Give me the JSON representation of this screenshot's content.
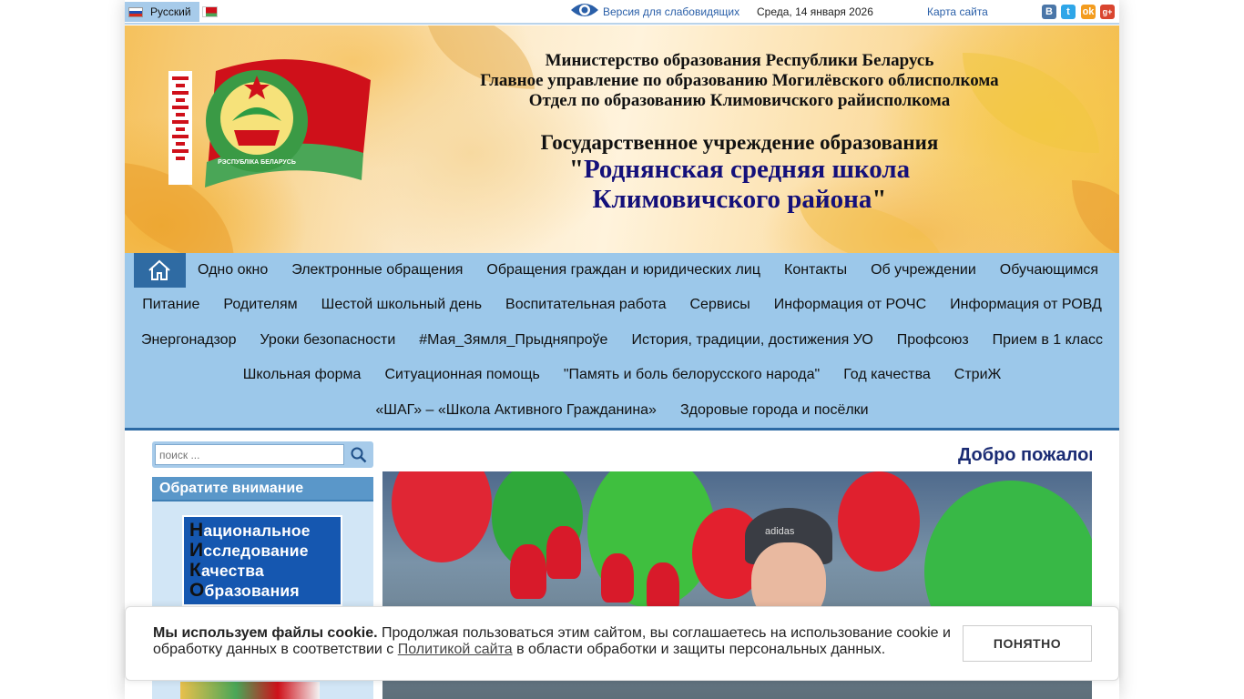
{
  "topbar": {
    "language": "Русский",
    "vision_link": "Версия для слабовидящих",
    "date": "Среда, 14 января 2026",
    "sitemap": "Карта сайта",
    "social": [
      {
        "icon": "vk-icon",
        "glyph": "В"
      },
      {
        "icon": "twitter-icon",
        "glyph": "t"
      },
      {
        "icon": "odnoklassniki-icon",
        "glyph": "ok"
      },
      {
        "icon": "google-plus-icon",
        "glyph": "g+"
      }
    ]
  },
  "header": {
    "line1": "Министерство образования Республики Беларусь",
    "line2": "Главное управление по образованию Могилёвского облисполкома",
    "line3": "Отдел по образованию Климовичского райисполкома",
    "line4": "Государственное учреждение образования",
    "line5": "Роднянская средняя школа",
    "line6": "Климовичского района",
    "quote_open": "\"",
    "quote_close": "\"",
    "emblem_text": "РЭСПУБЛІКА БЕЛАРУСЬ"
  },
  "nav": {
    "rows": [
      [
        "Одно окно",
        "Электронные обращения",
        "Обращения граждан и юридических лиц",
        "Контакты",
        "Об учреждении",
        "Обучающимся"
      ],
      [
        "Питание",
        "Родителям",
        "Шестой школьный день",
        "Воспитательная работа",
        "Сервисы",
        "Информация от РОЧС",
        "Информация от РОВД"
      ],
      [
        "Энергонадзор",
        "Уроки безопасности",
        "#Мая_Зямля_Прыдняпроўе",
        "История, традиции, достижения УО",
        "Профсоюз",
        "Прием в 1 класс"
      ],
      [
        "Школьная форма",
        "Ситуационная помощь",
        "\"Память и боль белорусского народа\"",
        "Год качества",
        "СтриЖ"
      ],
      [
        "«ШАГ» – «Школа Активного Гражданина»",
        "Здоровые города и посёлки"
      ]
    ]
  },
  "sidebar": {
    "search_placeholder": "поиск ...",
    "notice_title": "Обратите внимание",
    "niko": [
      {
        "first": "Н",
        "rest": "ациональное"
      },
      {
        "first": "И",
        "rest": "сследование"
      },
      {
        "first": "К",
        "rest": "ачества"
      },
      {
        "first": "О",
        "rest": "бразования"
      }
    ]
  },
  "main": {
    "welcome": "Добро пожаловать"
  },
  "photo": {
    "hat_brand": "adidas"
  },
  "cookie": {
    "bold": "Мы используем файлы cookie.",
    "text1": " Продолжая пользоваться этим сайтом, вы соглашаетесь на использование cookie и обработку данных в соответствии с ",
    "link": "Политикой сайта",
    "text2": " в области обработки и защиты персональных данных.",
    "button": "ПОНЯТНО"
  },
  "colors": {
    "nav_bg": "#9cc8ea",
    "home_bg": "#2f6ba3",
    "title_blue": "#14107a",
    "welcome": "#1a2b73"
  }
}
